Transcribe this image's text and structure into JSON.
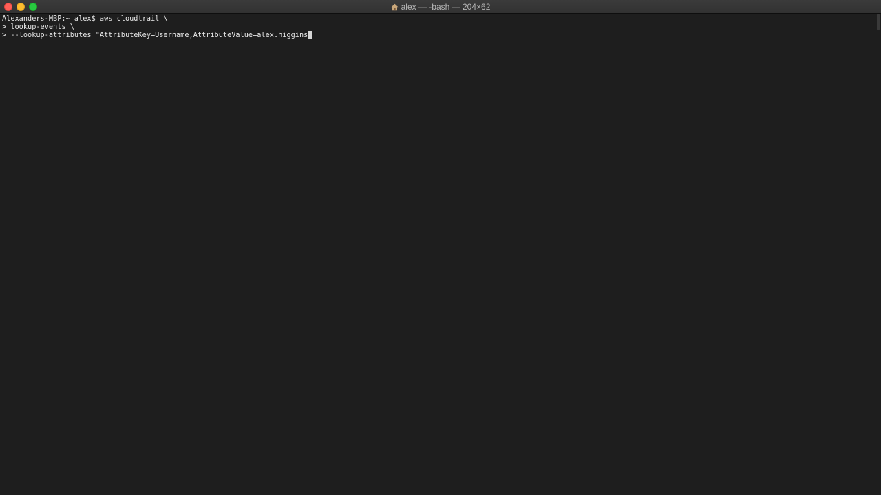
{
  "window": {
    "title": "alex — -bash — 204×62",
    "title_icon": "home-icon"
  },
  "terminal": {
    "lines": [
      "Alexanders-MBP:~ alex$ aws cloudtrail \\",
      "> lookup-events \\",
      "> --lookup-attributes \"AttributeKey=Username,AttributeValue=alex.higgins"
    ]
  },
  "colors": {
    "background": "#1e1e1e",
    "text": "#e6e6e6",
    "close": "#ff5f57",
    "minimize": "#febc2e",
    "maximize": "#28c840"
  }
}
